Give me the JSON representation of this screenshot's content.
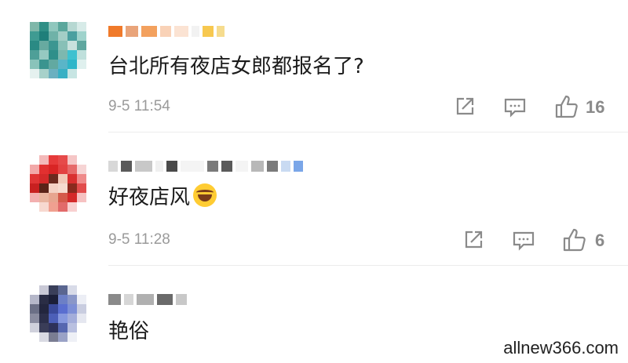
{
  "comments": [
    {
      "text": "台北所有夜店女郎都报名了?",
      "time": "9-5 11:54",
      "likes": "16"
    },
    {
      "text": "好夜店风",
      "emoji": "laughing-tears-emoji",
      "time": "9-5 11:28",
      "likes": "6"
    },
    {
      "text": "艳俗"
    }
  ],
  "icons": {
    "share": "share-icon",
    "reply": "comment-icon",
    "like": "thumbs-up-icon"
  },
  "watermark": "allnew366.com"
}
